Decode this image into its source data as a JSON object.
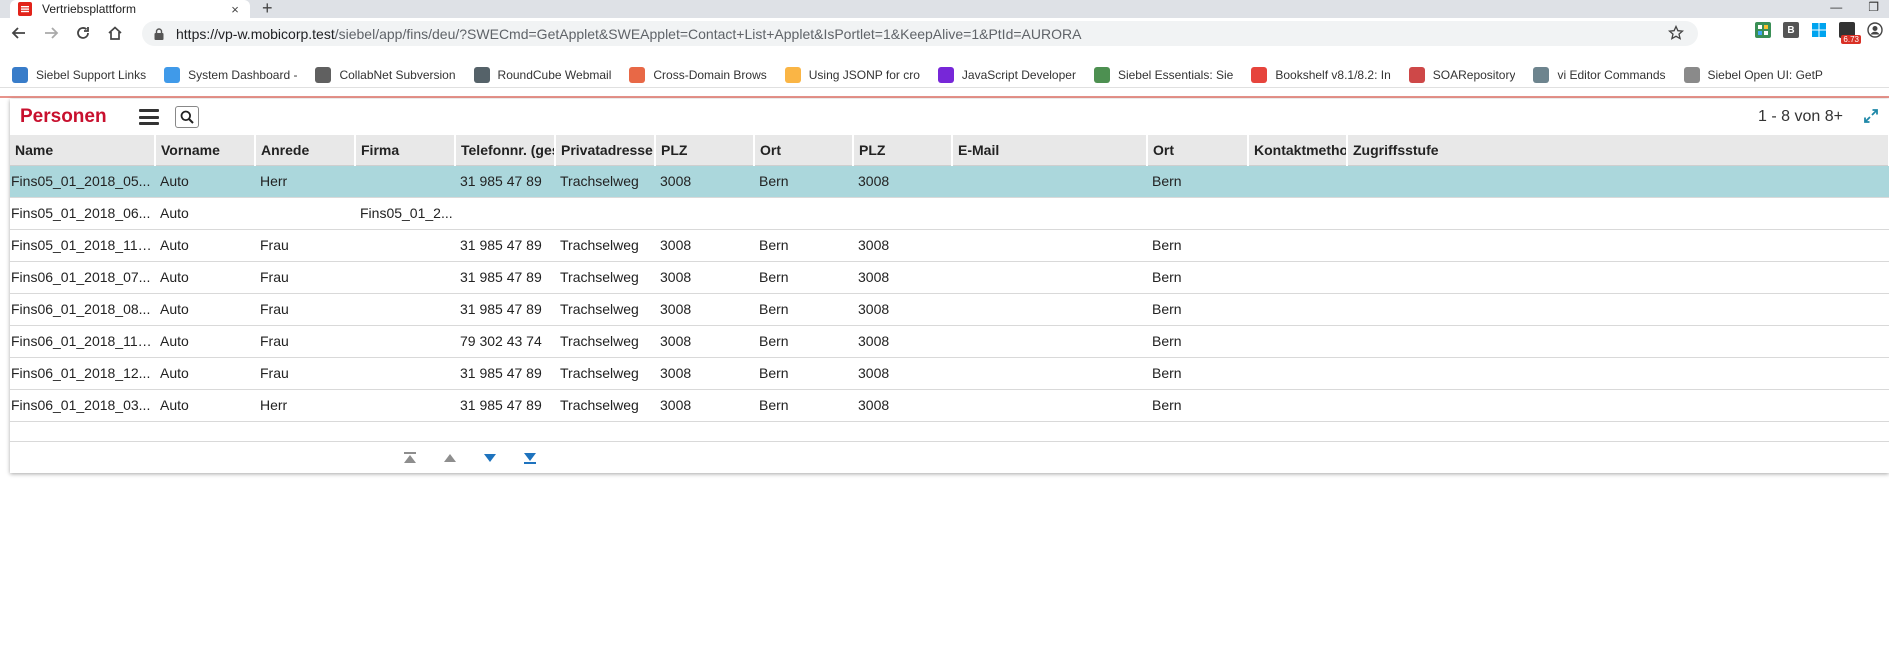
{
  "browser": {
    "tab_title": "Vertriebsplattform",
    "tab_close": "×",
    "new_tab": "+",
    "url_host": "https://vp-w.mobicorp.test",
    "url_path": "/siebel/app/fins/deu/?SWECmd=GetApplet&SWEApplet=Contact+List+Applet&IsPortlet=1&KeepAlive=1&PtId=AURORA",
    "ext_badge": "6.73",
    "ext_b_label": "B",
    "bookmarks": [
      {
        "label": "Siebel Support Links",
        "icon": "siebel-star-icon",
        "color": "#1565c0"
      },
      {
        "label": "System Dashboard -",
        "icon": "diamond-icon",
        "color": "#1e88e5"
      },
      {
        "label": "CollabNet Subversion",
        "icon": "sc-logo-icon",
        "color": "#444444"
      },
      {
        "label": "RoundCube Webmail",
        "icon": "roundcube-icon",
        "color": "#37474f"
      },
      {
        "label": "Cross-Domain Brows",
        "icon": "html5-icon",
        "color": "#e44d26"
      },
      {
        "label": "Using JSONP for cro",
        "icon": "sun-icon",
        "color": "#f9a825"
      },
      {
        "label": "JavaScript Developer",
        "icon": "yahoo-icon",
        "color": "#5f01d1"
      },
      {
        "label": "Siebel Essentials: Sie",
        "icon": "tree-icon",
        "color": "#2e7d32"
      },
      {
        "label": "Bookshelf v8.1/8.2: In",
        "icon": "oracle-icon",
        "color": "#e2231a"
      },
      {
        "label": "SOARepository",
        "icon": "pyramid-icon",
        "color": "#c62828"
      },
      {
        "label": "vi Editor Commands",
        "icon": "swirl-icon",
        "color": "#546e7a"
      },
      {
        "label": "Siebel Open UI: GetP",
        "icon": "pen-icon",
        "color": "#757575"
      }
    ]
  },
  "applet": {
    "title": "Personen",
    "record_count": "1 - 8 von 8+",
    "columns": [
      "Name",
      "Vorname",
      "Anrede",
      "Firma",
      "Telefonnr. (gesc",
      "Privatadresse",
      "PLZ",
      "Ort",
      "PLZ",
      "E-Mail",
      "Ort",
      "Kontaktmethod",
      "Zugriffsstufe"
    ],
    "rows": [
      [
        "Fins05_01_2018_05...",
        "Auto",
        "Herr",
        "",
        "31 985 47 89",
        "Trachselweg",
        "3008",
        "Bern",
        "3008",
        "",
        "Bern",
        "",
        ""
      ],
      [
        "Fins05_01_2018_06...",
        "Auto",
        "",
        "Fins05_01_2...",
        "",
        "",
        "",
        "",
        "",
        "",
        "",
        "",
        ""
      ],
      [
        "Fins05_01_2018_11_...",
        "Auto",
        "Frau",
        "",
        "31 985 47 89",
        "Trachselweg",
        "3008",
        "Bern",
        "3008",
        "",
        "Bern",
        "",
        ""
      ],
      [
        "Fins06_01_2018_07...",
        "Auto",
        "Frau",
        "",
        "31 985 47 89",
        "Trachselweg",
        "3008",
        "Bern",
        "3008",
        "",
        "Bern",
        "",
        ""
      ],
      [
        "Fins06_01_2018_08...",
        "Auto",
        "Frau",
        "",
        "31 985 47 89",
        "Trachselweg",
        "3008",
        "Bern",
        "3008",
        "",
        "Bern",
        "",
        ""
      ],
      [
        "Fins06_01_2018_11_...",
        "Auto",
        "Frau",
        "",
        "79 302 43 74",
        "Trachselweg",
        "3008",
        "Bern",
        "3008",
        "",
        "Bern",
        "",
        ""
      ],
      [
        "Fins06_01_2018_12...",
        "Auto",
        "Frau",
        "",
        "31 985 47 89",
        "Trachselweg",
        "3008",
        "Bern",
        "3008",
        "",
        "Bern",
        "",
        ""
      ],
      [
        "Fins06_01_2018_03...",
        "Auto",
        "Herr",
        "",
        "31 985 47 89",
        "Trachselweg",
        "3008",
        "Bern",
        "3008",
        "",
        "Bern",
        "",
        ""
      ]
    ],
    "selected_row": 0,
    "colors": {
      "accent": "#c8102e",
      "selected_row": "#abd7dc",
      "header_bg": "#e8e8e8",
      "pager_inactive": "#8e8e8e",
      "pager_active": "#1e73be"
    }
  }
}
